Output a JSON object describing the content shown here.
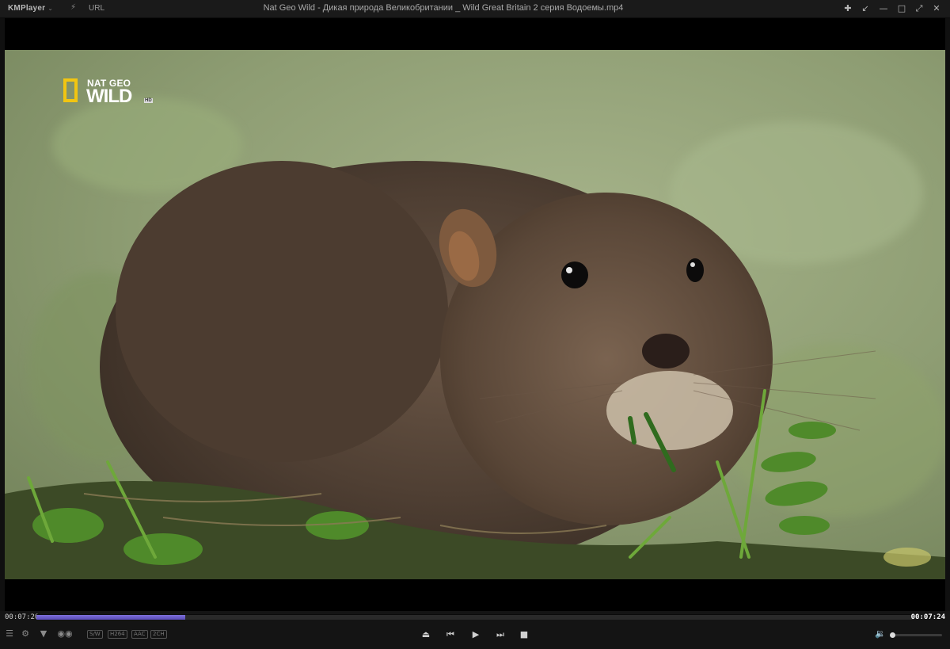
{
  "titlebar": {
    "app_name": "KMPlayer",
    "app_menu_icon": "chevron-down-icon",
    "url_label": "URL",
    "window_title": "Nat Geo Wild - Дикая природа Великобритании _ Wild Great Britain 2 серия  Водоемы.mp4",
    "buttons": [
      "pin-icon",
      "compact-mode-icon",
      "minimize-icon",
      "maximize-icon",
      "fullscreen-icon",
      "close-icon"
    ]
  },
  "video": {
    "channel_logo": {
      "line1": "NAT GEO",
      "line2": "WILD",
      "badge": "HD"
    }
  },
  "playback": {
    "current_time": "00:07:20",
    "total_time": "00:07:24",
    "progress_fraction": 0.17
  },
  "badges": [
    "S/W",
    "H264",
    "AAC",
    "2CH"
  ],
  "controls": {
    "left_icons": [
      "menu-icon",
      "settings-icon",
      "3d-icon",
      "vr-icon"
    ],
    "playback_icons": [
      "eject-icon",
      "previous-icon",
      "play-icon",
      "next-icon",
      "stop-icon"
    ],
    "volume_fraction": 0.0
  },
  "colors": {
    "accent": "#6a5cc8",
    "background": "#101010",
    "logo_yellow": "#f2c511"
  }
}
